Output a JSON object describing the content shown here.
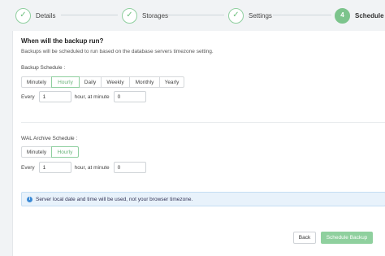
{
  "stepper": {
    "steps": [
      {
        "label": "Details",
        "marker": "✓"
      },
      {
        "label": "Storages",
        "marker": "✓"
      },
      {
        "label": "Settings",
        "marker": "✓"
      },
      {
        "label": "Schedule",
        "marker": "4"
      }
    ]
  },
  "form": {
    "title": "When will the backup run?",
    "description": "Backups will be scheduled to run based on the database servers timezone setting.",
    "backup_schedule": {
      "label": "Backup Schedule :",
      "options": [
        "Minutely",
        "Hourly",
        "Daily",
        "Weekly",
        "Monthly",
        "Yearly"
      ],
      "selected": "Hourly",
      "every_label": "Every",
      "every_value": "1",
      "unit_label": "hour, at minute",
      "minute_value": "0"
    },
    "wal_schedule": {
      "label": "WAL Archive Schedule :",
      "options": [
        "Minutely",
        "Hourly"
      ],
      "selected": "Hourly",
      "every_label": "Every",
      "every_value": "1",
      "unit_label": "hour, at minute",
      "minute_value": "0"
    },
    "info_text": "Server local date and time will be used, not your browser timezone.",
    "back_label": "Back",
    "submit_label": "Schedule Backup"
  },
  "colors": {
    "accent": "#7cc48c",
    "info_bg": "#e8f2fb",
    "info_icon": "#3d8bd6"
  }
}
